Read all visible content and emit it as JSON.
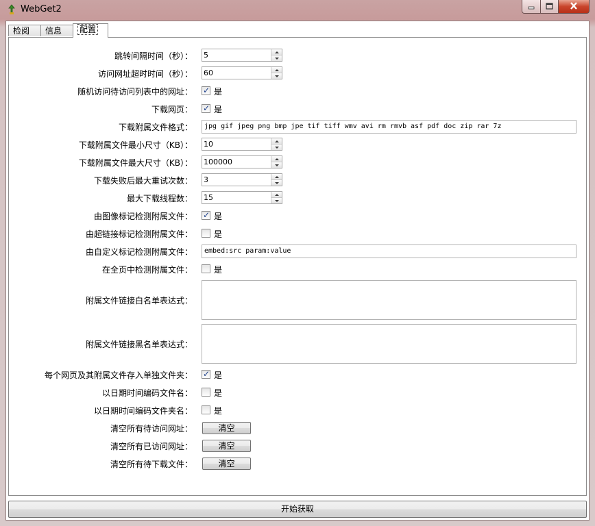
{
  "window": {
    "title": "WebGet2",
    "controls": {
      "minimize": "minimize-icon",
      "maximize": "maximize-icon",
      "close": "close-icon"
    }
  },
  "tabs": [
    {
      "label": "检阅"
    },
    {
      "label": "信息"
    },
    {
      "label": "配置",
      "active": true
    }
  ],
  "settings": {
    "jump_interval": {
      "label": "跳转间隔时间（秒）：",
      "value": "5"
    },
    "access_timeout": {
      "label": "访问网址超时时间（秒）：",
      "value": "60"
    },
    "random_access": {
      "label": "随机访问待访问列表中的网址：",
      "checked": true,
      "text": "是"
    },
    "download_pages": {
      "label": "下载网页：",
      "checked": true,
      "text": "是"
    },
    "attachment_formats": {
      "label": "下载附属文件格式：",
      "value": "jpg gif jpeg png bmp jpe tif tiff wmv avi rm rmvb asf pdf doc zip rar 7z"
    },
    "min_size": {
      "label": "下载附属文件最小尺寸（KB）：",
      "value": "10"
    },
    "max_size": {
      "label": "下载附属文件最大尺寸（KB）：",
      "value": "100000"
    },
    "max_retries": {
      "label": "下载失败后最大重试次数：",
      "value": "3"
    },
    "max_threads": {
      "label": "最大下载线程数：",
      "value": "15"
    },
    "detect_by_image": {
      "label": "由图像标记检测附属文件：",
      "checked": true,
      "text": "是"
    },
    "detect_by_link": {
      "label": "由超链接标记检测附属文件：",
      "checked": false,
      "text": "是"
    },
    "detect_by_custom": {
      "label": "由自定义标记检测附属文件：",
      "value": "embed:src param:value"
    },
    "detect_full_page": {
      "label": "在全页中检测附属文件：",
      "checked": false,
      "text": "是"
    },
    "whitelist": {
      "label": "附属文件链接白名单表达式：",
      "value": ""
    },
    "blacklist": {
      "label": "附属文件链接黑名单表达式：",
      "value": ""
    },
    "separate_folder": {
      "label": "每个网页及其附属文件存入单独文件夹：",
      "checked": true,
      "text": "是"
    },
    "date_filename": {
      "label": "以日期时间编码文件名：",
      "checked": false,
      "text": "是"
    },
    "date_foldername": {
      "label": "以日期时间编码文件夹名：",
      "checked": false,
      "text": "是"
    },
    "clear_pending": {
      "label": "清空所有待访问网址：",
      "button": "清空"
    },
    "clear_visited": {
      "label": "清空所有已访问网址：",
      "button": "清空"
    },
    "clear_downloads": {
      "label": "清空所有待下载文件：",
      "button": "清空"
    }
  },
  "start_button": "开始获取"
}
